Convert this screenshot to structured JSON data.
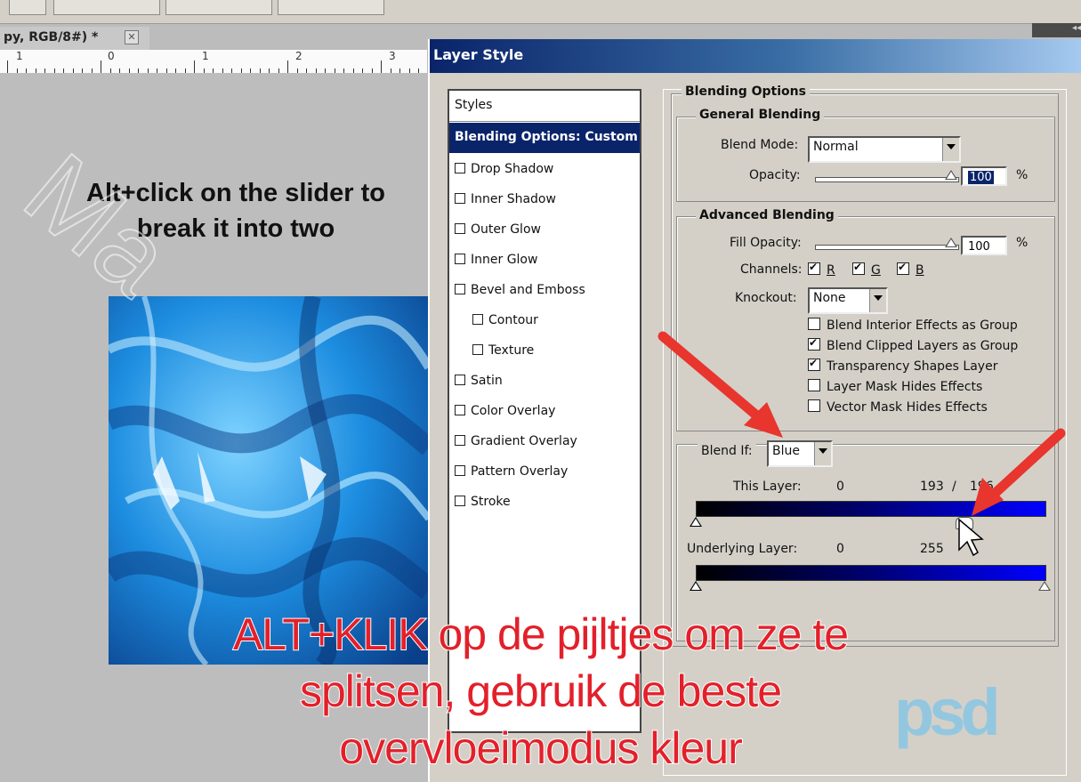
{
  "document": {
    "tab_title": "py, RGB/8#) *",
    "ruler_numbers": [
      "1",
      "0",
      "1",
      "2",
      "3"
    ]
  },
  "canvas": {
    "hint_line1": "Alt+click on the slider to",
    "hint_line2": "break it into two"
  },
  "dialog": {
    "title": "Layer Style",
    "styles_header": "Styles",
    "styles": [
      {
        "label": "Blending Options: Custom",
        "selected": true
      },
      {
        "label": "Drop Shadow",
        "checked": false
      },
      {
        "label": "Inner Shadow",
        "checked": false
      },
      {
        "label": "Outer Glow",
        "checked": false
      },
      {
        "label": "Inner Glow",
        "checked": false
      },
      {
        "label": "Bevel and Emboss",
        "checked": false
      },
      {
        "label": "Contour",
        "checked": false
      },
      {
        "label": "Texture",
        "checked": false
      },
      {
        "label": "Satin",
        "checked": false
      },
      {
        "label": "Color Overlay",
        "checked": false
      },
      {
        "label": "Gradient Overlay",
        "checked": false
      },
      {
        "label": "Pattern Overlay",
        "checked": false
      },
      {
        "label": "Stroke",
        "checked": false
      }
    ],
    "blending_options": {
      "title": "Blending Options",
      "general": {
        "title": "General Blending",
        "blend_mode_label": "Blend Mode:",
        "blend_mode_value": "Normal",
        "opacity_label": "Opacity:",
        "opacity_value": "100",
        "opacity_unit": "%"
      },
      "advanced": {
        "title": "Advanced Blending",
        "fill_opacity_label": "Fill Opacity:",
        "fill_opacity_value": "100",
        "fill_opacity_unit": "%",
        "channels_label": "Channels:",
        "channels": [
          {
            "label": "R",
            "checked": true
          },
          {
            "label": "G",
            "checked": true
          },
          {
            "label": "B",
            "checked": true
          }
        ],
        "knockout_label": "Knockout:",
        "knockout_value": "None",
        "options": [
          {
            "label": "Blend Interior Effects as Group",
            "checked": false
          },
          {
            "label": "Blend Clipped Layers as Group",
            "checked": true
          },
          {
            "label": "Transparency Shapes Layer",
            "checked": true
          },
          {
            "label": "Layer Mask Hides Effects",
            "checked": false
          },
          {
            "label": "Vector Mask Hides Effects",
            "checked": false
          }
        ]
      },
      "blend_if": {
        "label": "Blend If:",
        "value": "Blue",
        "this_layer_label": "This Layer:",
        "this_layer_low": "0",
        "this_layer_high_a": "193",
        "this_layer_sep": "/",
        "this_layer_high_b": "196",
        "underlying_label": "Underlying Layer:",
        "underlying_low": "0",
        "underlying_high": "255"
      }
    }
  },
  "overlay": {
    "caption_line1_a": "ALT+KLIK",
    "caption_line1_b": "op de pijltjes om ze te",
    "caption_line2": "splitsen, gebruik de beste",
    "caption_line3": "overvloeimodus kleur",
    "logo_text": "psd"
  },
  "colors": {
    "caption": "#e3202a",
    "title_bar": "#0a246a",
    "arrow": "#e8352e"
  }
}
